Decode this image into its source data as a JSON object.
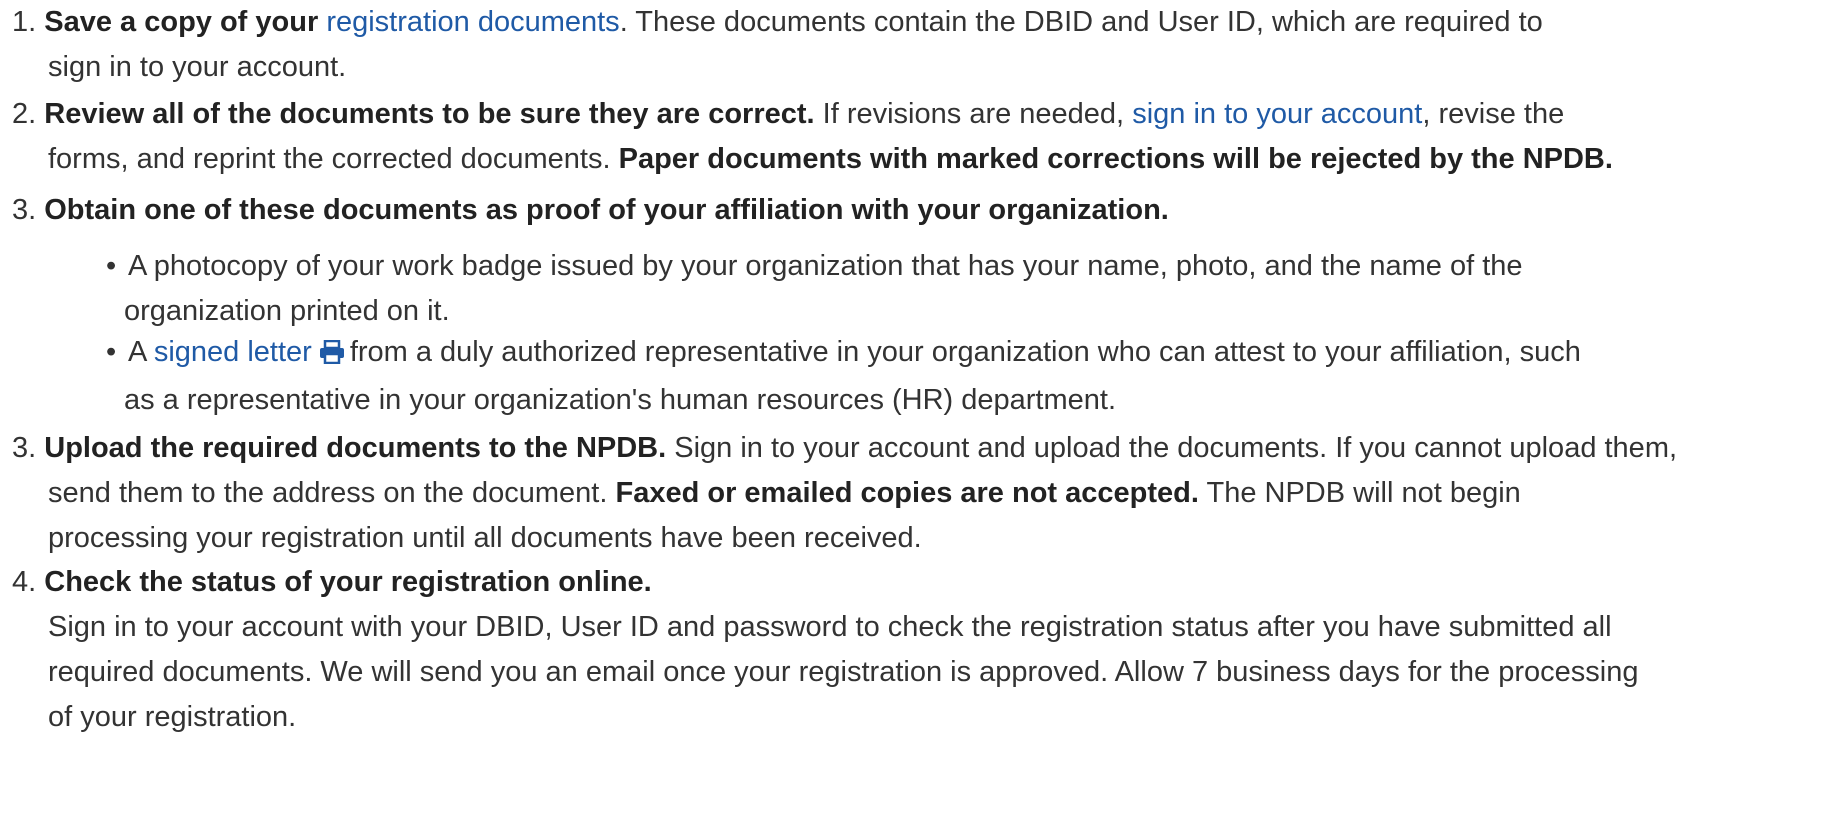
{
  "steps": [
    {
      "number": "1.",
      "title": "Save a copy of your",
      "link": "registration documents",
      "text_after_link": ". These documents contain the DBID and User ID, which are required to",
      "continuation": "sign in to  your account."
    },
    {
      "number": "2.",
      "title": "Review all of the documents to be sure they are correct.",
      "text_before_link": "If revisions are needed,",
      "link": "sign in to your account",
      "text_after_link": ", revise the",
      "continuation": "forms, and reprint  the corrected documents.",
      "bold_note": "Paper documents with marked corrections will be rejected by the NPDB."
    },
    {
      "number": "3.",
      "title": "Obtain one of these documents as proof of your affiliation with your organization.",
      "bullets": [
        {
          "line1": "A photocopy of your work badge issued by your organization that has your name, photo, and the name of the",
          "line2": "organization  printed on it."
        },
        {
          "prefix": "A",
          "link": "signed letter",
          "icon": "printer-icon",
          "line1_after": "from a duly authorized representative in your organization who can attest to your affiliation, such",
          "line2": "as a  representative  in your organization's   human resources (HR) department."
        }
      ]
    },
    {
      "number": "3.",
      "title": "Upload the required documents to the NPDB.",
      "text": "Sign in to your account and upload the documents. If you cannot upload them,",
      "line2_before": "send  them to  the address on the document.",
      "bold_note": "Faxed or emailed copies are not accepted.",
      "line2_after": "The NPDB will not begin",
      "line3": "processing  your  registration  until all  documents have been received."
    },
    {
      "number": "4.",
      "title": "Check the status of your registration online.",
      "line2": "Sign in to your account  with your  DBID, User ID and  password to check the registration status  after you have submitted all",
      "line3": "required  documents.  We will send   you an email once your registration is approved.  Allow 7 business days  for the processing",
      "line4": "of  your registration."
    }
  ],
  "colors": {
    "link": "#1f5aa6",
    "text": "#333333",
    "bold": "#222222"
  }
}
